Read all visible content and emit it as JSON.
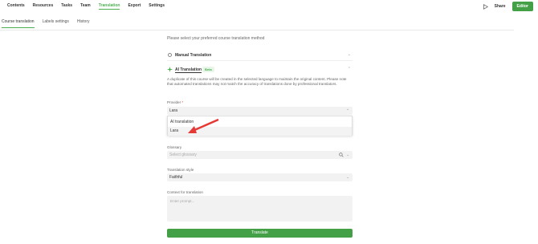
{
  "topnav": {
    "items": [
      "Contents",
      "Resources",
      "Tasks",
      "Team",
      "Translation",
      "Export",
      "Settings"
    ],
    "active_index": 4
  },
  "top_right": {
    "share_label": "Share",
    "editor_label": "Editor",
    "play_icon": "play-icon"
  },
  "subtabs": {
    "items": [
      "Course translation",
      "Labels settings",
      "History"
    ],
    "active_index": 0
  },
  "main": {
    "prompt": "Please select your preferred course translation method",
    "manual_label": "Manual Translation",
    "ai_label": "AI Translation",
    "beta_label": "Beta",
    "description": "A duplicate of this course will be created in the selected language to maintain the original content. Please note that automated translations may not match the accuracy of translations done by professional translators.",
    "provider_label": "Provider",
    "provider_required": "*",
    "provider_value": "Lara",
    "dropdown_options": [
      "AI translation",
      "Lara"
    ],
    "glossary_label": "Glossary",
    "glossary_placeholder": "Select glossary",
    "style_label": "Translation style",
    "style_value": "Faithful",
    "context_label": "Context for translation",
    "context_placeholder": "Enter prompt...",
    "translate_label": "Translate"
  },
  "colors": {
    "accent": "#43a047",
    "arrow": "#e53935"
  }
}
